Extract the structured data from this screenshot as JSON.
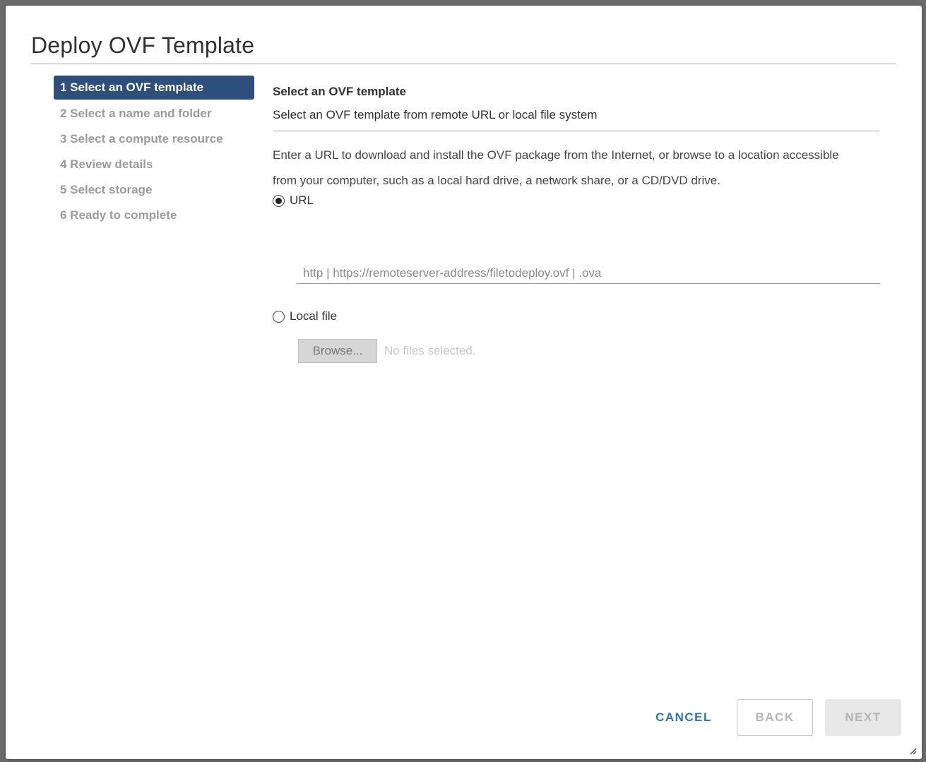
{
  "dialog": {
    "title": "Deploy OVF Template"
  },
  "steps": [
    {
      "label": "1 Select an OVF template",
      "active": true
    },
    {
      "label": "2 Select a name and folder",
      "active": false
    },
    {
      "label": "3 Select a compute resource",
      "active": false
    },
    {
      "label": "4 Review details",
      "active": false
    },
    {
      "label": "5 Select storage",
      "active": false
    },
    {
      "label": "6 Ready to complete",
      "active": false
    }
  ],
  "section": {
    "title": "Select an OVF template",
    "subtitle": "Select an OVF template from remote URL or local file system",
    "description": "Enter a URL to download and install the OVF package from the Internet, or browse to a location accessible from your computer, such as a local hard drive, a network share, or a CD/DVD drive."
  },
  "source": {
    "url_option_label": "URL",
    "url_selected": true,
    "url_value": "",
    "url_placeholder": "http | https://remoteserver-address/filetodeploy.ovf | .ova",
    "local_option_label": "Local file",
    "local_selected": false,
    "browse_label": "Browse...",
    "no_files_text": "No files selected."
  },
  "footer": {
    "cancel_label": "CANCEL",
    "back_label": "BACK",
    "next_label": "NEXT"
  },
  "icons": {
    "radio_selected": "radio-selected-icon",
    "radio_unselected": "radio-unselected-icon",
    "resize": "resize-grip-icon"
  },
  "colors": {
    "active_step_bg": "#2e4e7c",
    "link_blue": "#2d74b0"
  }
}
